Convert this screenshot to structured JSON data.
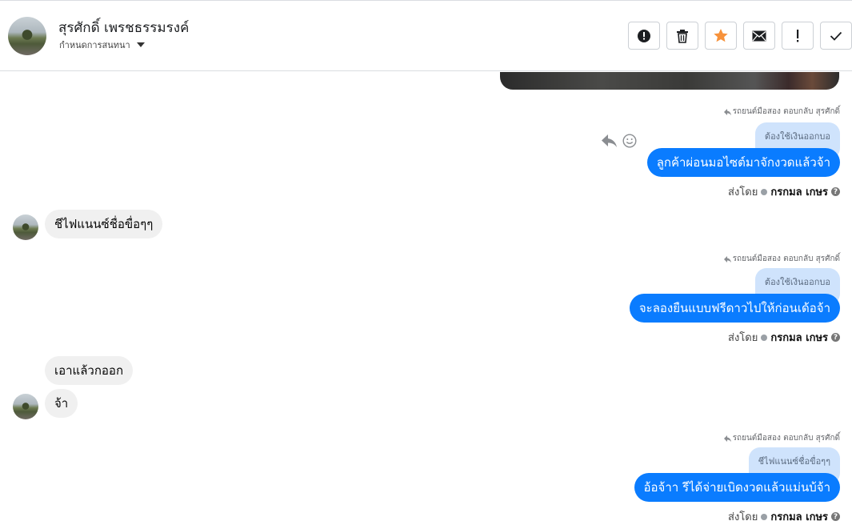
{
  "header": {
    "name": "สุรศักดิ์ เพรชธรรมรงค์",
    "subtitle": "กำหนดการสนทนา"
  },
  "toolbar": {
    "buttons": [
      {
        "name": "report-icon"
      },
      {
        "name": "trash-icon"
      },
      {
        "name": "star-icon",
        "color": "#f7923b"
      },
      {
        "name": "mail-icon"
      },
      {
        "name": "exclamation-icon"
      },
      {
        "name": "check-icon"
      }
    ]
  },
  "messages": {
    "m1": {
      "meta": "รถยนต์มือสอง ตอบกลับ สุรศักดิ์",
      "reply_to": "ต้องใช้เงินออกบอ",
      "text": "ลูกค้าผ่อนมอไซต์มาจักงวดแล้วจ้า",
      "sent_by_label": "ส่งโดย",
      "sender": "กรกมล เกษร"
    },
    "m2": {
      "text": "ชีไฟแนนซ์ชื่อขื่อๆๆ"
    },
    "m3": {
      "meta": "รถยนต์มือสอง ตอบกลับ สุรศักดิ์",
      "reply_to": "ต้องใช้เงินออกบอ",
      "text": "จะลองยืนแบบฟรีดาวไปให้ก่อนเด้อจ้า",
      "sent_by_label": "ส่งโดย",
      "sender": "กรกมล เกษร"
    },
    "m4": {
      "text": "เอาแล้วกออก"
    },
    "m5": {
      "text": "จ้า"
    },
    "m6": {
      "meta": "รถยนต์มือสอง ตอบกลับ สุรศักดิ์",
      "reply_to": "ชีไฟแนนซ์ชื่อขื่อๆๆ",
      "text": "อ้อจ้าา รีได้จ่ายเบิดงวดแล้วแม่นบ้จ้า",
      "sent_by_label": "ส่งโดย",
      "sender": "กรกมล เกษร"
    }
  },
  "colors": {
    "outgoing": "#0a7cff",
    "reply_bg": "#cfe3fc",
    "incoming": "#f0f0f0"
  }
}
